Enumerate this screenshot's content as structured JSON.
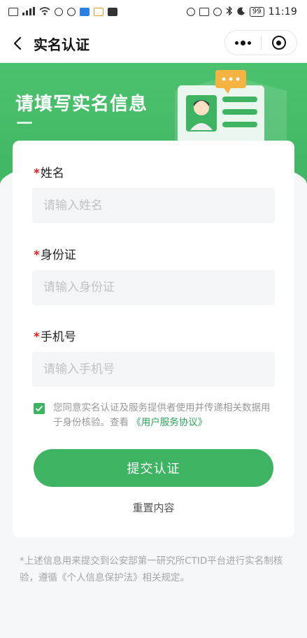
{
  "status_bar": {
    "left_icons": [
      "hd-icon",
      "signal-icon",
      "wifi-icon",
      "headset-icon",
      "app-icon",
      "app-icon-2",
      "app-icon-3",
      "app-icon-4"
    ],
    "right_icons": [
      "eye-icon",
      "nfc-icon",
      "mute-icon",
      "bluetooth-icon",
      "moon-icon"
    ],
    "battery": "99",
    "time": "11:19"
  },
  "navbar": {
    "title": "实名认证"
  },
  "banner": {
    "title": "请填写实名信息"
  },
  "form": {
    "fields": [
      {
        "label": "姓名",
        "placeholder": "请输入姓名",
        "value": ""
      },
      {
        "label": "身份证",
        "placeholder": "请输入身份证",
        "value": ""
      },
      {
        "label": "手机号",
        "placeholder": "请输入手机号",
        "value": ""
      }
    ],
    "required_mark": "*",
    "agreement": {
      "checked": true,
      "text": "您同意实名认证及服务提供者使用并传递相关数据用于身份核验。查看",
      "link": "《用户服务协议》"
    },
    "submit_label": "提交认证",
    "reset_label": "重置内容"
  },
  "footnote": "*上述信息用来提交到公安部第一研究所CTID平台进行实名制核验，遵循《个人信息保护法》相关规定。",
  "colors": {
    "primary_green": "#3eb463",
    "required_red": "#e02020",
    "link_green": "#2aa65a"
  }
}
